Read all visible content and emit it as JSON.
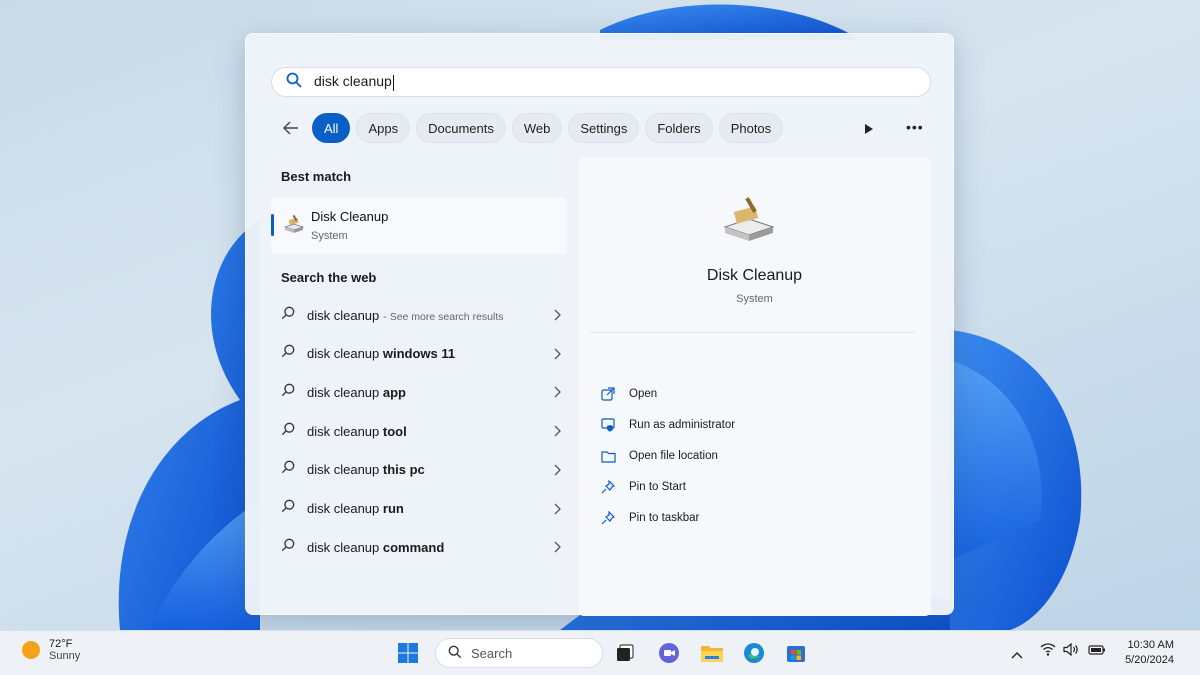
{
  "search": {
    "query": "disk cleanup"
  },
  "filters": [
    "All",
    "Apps",
    "Documents",
    "Web",
    "Settings",
    "Folders",
    "Photos"
  ],
  "best_match": {
    "title": "Best match",
    "name": "Disk Cleanup",
    "sub": "System"
  },
  "web": {
    "title": "Search the web",
    "rows": [
      {
        "base": "disk cleanup",
        "bold": "",
        "hint": "- See more search results"
      },
      {
        "base": "disk cleanup ",
        "bold": "windows 11",
        "hint": ""
      },
      {
        "base": "disk cleanup ",
        "bold": "app",
        "hint": ""
      },
      {
        "base": "disk cleanup ",
        "bold": "tool",
        "hint": ""
      },
      {
        "base": "disk cleanup ",
        "bold": "this pc",
        "hint": ""
      },
      {
        "base": "disk cleanup ",
        "bold": "run",
        "hint": ""
      },
      {
        "base": "disk cleanup ",
        "bold": "command",
        "hint": ""
      }
    ]
  },
  "detail": {
    "name": "Disk Cleanup",
    "sub": "System",
    "actions": [
      "Open",
      "Run as administrator",
      "Open file location",
      "Pin to Start",
      "Pin to taskbar"
    ]
  },
  "taskbar": {
    "weather_temp": "72°F",
    "weather_desc": "Sunny",
    "search_label": "Search",
    "time": "10:30 AM",
    "date": "5/20/2024"
  },
  "colors": {
    "accent": "#0a5fc4",
    "wallpaper_blue": "#1f6fe0"
  }
}
